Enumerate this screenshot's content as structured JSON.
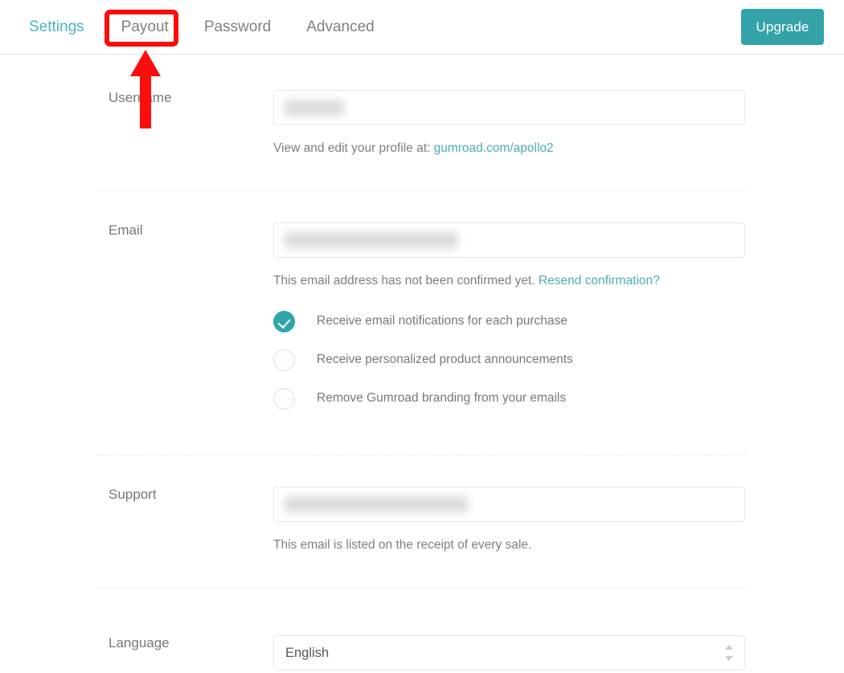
{
  "header": {
    "tabs": [
      {
        "label": "Settings",
        "active": true,
        "name": "tab-settings"
      },
      {
        "label": "Payout",
        "active": false,
        "name": "tab-payout"
      },
      {
        "label": "Password",
        "active": false,
        "name": "tab-password"
      },
      {
        "label": "Advanced",
        "active": false,
        "name": "tab-advanced"
      }
    ],
    "upgrade_label": "Upgrade"
  },
  "colors": {
    "accent_teal": "#34a3a8",
    "link_teal": "#4aadb5",
    "annotation_red": "#fb0d0d",
    "text_gray": "#72777a",
    "border_gray": "#e4e6e7"
  },
  "form": {
    "username": {
      "label": "Username",
      "value": "",
      "redacted": true,
      "helper_prefix": "View and edit your profile at: ",
      "helper_link": "gumroad.com/apollo2"
    },
    "email": {
      "label": "Email",
      "value": "",
      "redacted": true,
      "helper_prefix": "This email address has not been confirmed yet. ",
      "helper_link": "Resend confirmation?",
      "options": [
        {
          "label": "Receive email notifications for each purchase",
          "checked": true,
          "name": "checkbox-email-notifications"
        },
        {
          "label": "Receive personalized product announcements",
          "checked": false,
          "name": "checkbox-product-announcements"
        },
        {
          "label": "Remove Gumroad branding from your emails",
          "checked": false,
          "name": "checkbox-remove-branding"
        }
      ]
    },
    "support": {
      "label": "Support",
      "value": "",
      "redacted": true,
      "helper_prefix": "This email is listed on the receipt of every sale.",
      "helper_link": ""
    },
    "language": {
      "label": "Language",
      "value": "English"
    }
  },
  "annotations": {
    "highlight_target": "Payout",
    "arrow_direction": "up"
  }
}
